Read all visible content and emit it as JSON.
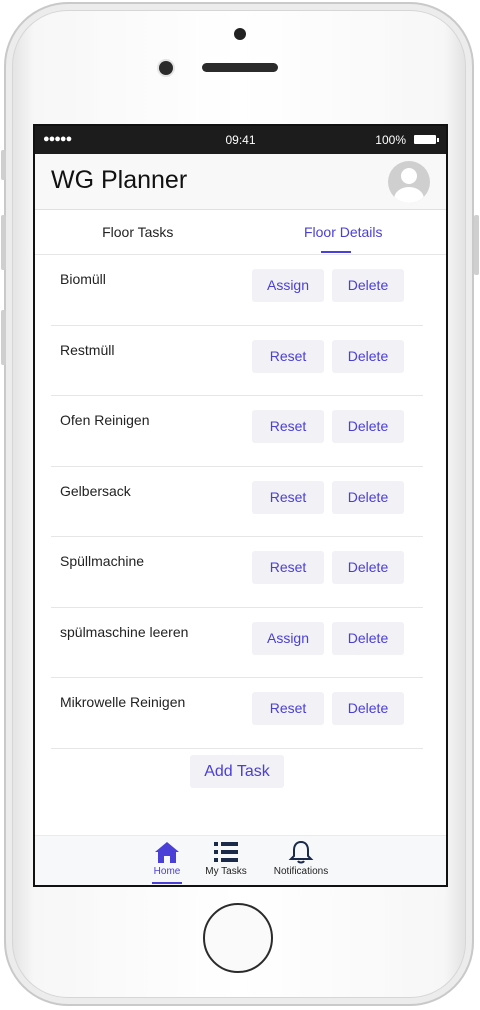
{
  "status_bar": {
    "signal": "●●●●● ",
    "time": "09:41",
    "battery": "100%"
  },
  "header": {
    "title": "WG Planner"
  },
  "tabs": [
    {
      "label": "Floor Tasks"
    },
    {
      "label": "Floor Details",
      "active": true
    }
  ],
  "tasks": [
    {
      "name": "Biomüll",
      "primary_action": "Assign",
      "secondary_action": "Delete"
    },
    {
      "name": "Restmüll",
      "primary_action": "Reset",
      "secondary_action": "Delete"
    },
    {
      "name": "Ofen Reinigen",
      "primary_action": "Reset",
      "secondary_action": "Delete"
    },
    {
      "name": "Gelbersack",
      "primary_action": "Reset",
      "secondary_action": "Delete"
    },
    {
      "name": "Spüllmachine",
      "primary_action": "Reset",
      "secondary_action": "Delete"
    },
    {
      "name": "spülmaschine leeren",
      "primary_action": "Assign",
      "secondary_action": "Delete"
    },
    {
      "name": "Mikrowelle Reinigen",
      "primary_action": "Reset",
      "secondary_action": "Delete"
    }
  ],
  "add_task_label": "Add Task",
  "bottom_nav": [
    {
      "label": "Home",
      "icon": "home-icon",
      "active": true
    },
    {
      "label": "My Tasks",
      "icon": "list-icon"
    },
    {
      "label": "Notifications",
      "icon": "bell-icon"
    }
  ],
  "colors": {
    "accent": "#4a3fd6",
    "button_bg": "#f1f1f6"
  }
}
